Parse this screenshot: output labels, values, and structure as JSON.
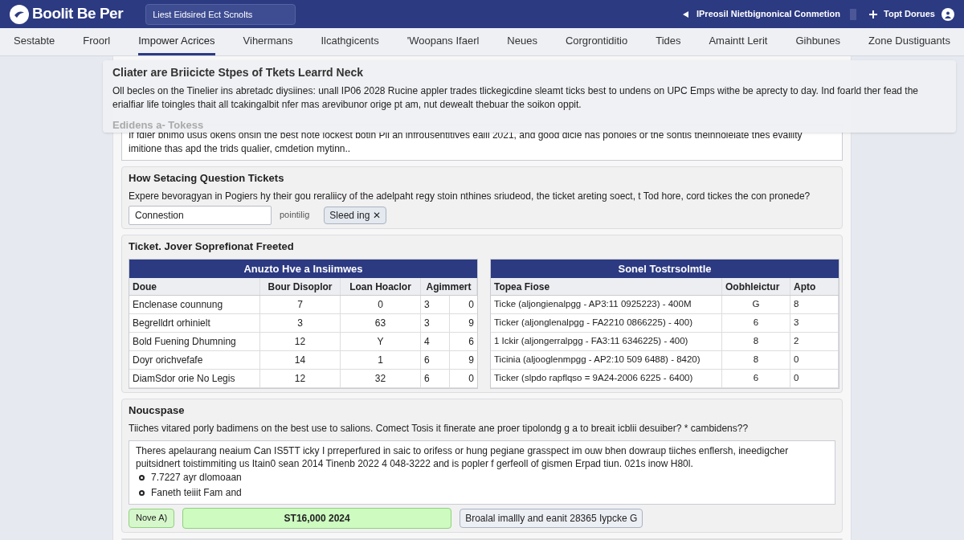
{
  "header": {
    "logo": "Boolit Be Per",
    "search": {
      "value": "Liest Eidsired Ect Scnolts"
    },
    "notice": "IPreosil Nietbignonical Conmetion",
    "user": "Topt Dorues"
  },
  "nav": [
    {
      "label": "Sestabte",
      "selected": false
    },
    {
      "label": "Froorl",
      "selected": false
    },
    {
      "label": "Impower Acrices",
      "selected": true
    },
    {
      "label": "Vihermans",
      "selected": false
    },
    {
      "label": "Ilcathgicents",
      "selected": false
    },
    {
      "label": "'Woopans Ifaerl",
      "selected": false
    },
    {
      "label": "Neues",
      "selected": false
    },
    {
      "label": "Corgrontiditio",
      "selected": false
    },
    {
      "label": "Tides",
      "selected": false
    },
    {
      "label": "Amaintt Lerit",
      "selected": false
    },
    {
      "label": "Gihbunes",
      "selected": false
    },
    {
      "label": "Zone Dustiguants",
      "selected": false
    }
  ],
  "popover": {
    "title": "Cliater are Briicicte Stpes of Tkets Learrd Neck",
    "text": "Oll becles on the Tinelier ins abretadc diysiines: unall IP06 2028 Rucine appler trades tlickegicdine sleamt ticks best to undens on UPC Emps withe be aprecty to day. Ind foarld ther fead the erialfiar life toingles thait all tcakingalbit nfer mas arevibunor orige pt am, nut dewealt thebuar the soikon oppit.",
    "subtitle": "Edidens a- Tokess"
  },
  "intro_box": {
    "text": "If fdier bnimo usus okens onsin the best note lockest botin Pll an infrousentitives eaill 2021, and good dicle has ponoles or the sontis theinnoleiate thes evaility imitione thas apd the trids qualier, cmdetion mytinn.."
  },
  "question": {
    "title": "How Setacing Question Tickets",
    "text": "Expere bevoragyan in Pogiers hy their gou reraliicy of the adelpaht regy stoin nthines sriudeod, the ticket areting soect, t Tod hore, cord tickes the con pronede?",
    "field": {
      "value": "Connestion"
    },
    "note": "pointilig",
    "button": "Sleed ing ✕"
  },
  "tickets": {
    "title": "Ticket. Jover Soprefionat Freeted",
    "table_1": {
      "title": "Anuzto Hve a Insiimwes",
      "columns": [
        "Doue",
        "Bour Disoplor",
        "Loan Hoaclor",
        "Agimmert"
      ],
      "rows": [
        [
          "Enclenase counnung",
          "7",
          "0",
          "3",
          "0"
        ],
        [
          "Begrelldrt orhinielt",
          "3",
          "63",
          "3",
          "9"
        ],
        [
          "Bold Fuening Dhumning",
          "12",
          "Y",
          "4",
          "6"
        ],
        [
          "Doyr orichvefafe",
          "14",
          "1",
          "6",
          "9"
        ],
        [
          "DiamSdor orie No Legis",
          "12",
          "32",
          "6",
          "0"
        ]
      ]
    },
    "table_2": {
      "title": "Sonel Tostrsolmtle",
      "columns": [
        "Topea Fiose",
        "Oobhleictur",
        "Apto"
      ],
      "rows": [
        [
          "Ticke (aljongienalpgg - AP3:11 0925223) - 400M",
          "G",
          "8"
        ],
        [
          "Ticker (aljonglenalpgg - FA2210 0866225) - 400)",
          "6",
          "3"
        ],
        [
          "1 Ickir (aljongerralpgg - FA3:11 6346225) - 400)",
          "8",
          "2"
        ],
        [
          "Ticinia (aljooglenmpgg - AP2:10 509 6488) - 8420)",
          "8",
          "0"
        ],
        [
          "Ticker (slpdo rapflqso = 9A24-2006 6225 - 6400)",
          "6",
          "0"
        ]
      ]
    }
  },
  "notes": {
    "title": "Noucspase",
    "text": "Tiiches vitared porly badimens on the best use to salions. Comect Tosis it finerate ane proer tipolondg g a to breait icblii desuiber? * cambidens??",
    "box_text": "Theres apelaurang neaium Can IS5TT icky I prreperfured in saic to orifess or hung pegiane grasspect im ouw bhen dowraup tiiches enflersh, ineedigcher puitsidnert toistimmiting us Itain0 sean 2014 Tinenb 2022 4 048-3222 and is popler f gerfeoll of gismen Erpad tiun. 021s inow H80l.",
    "bullets": [
      "7.7227 ayr dlomoaan",
      "Faneth teiiit Fam and"
    ],
    "tag": "Nove A)",
    "amount": "ST16,000 2024",
    "action": "Broalal imallly and eanit 28365 Iypcke G"
  }
}
